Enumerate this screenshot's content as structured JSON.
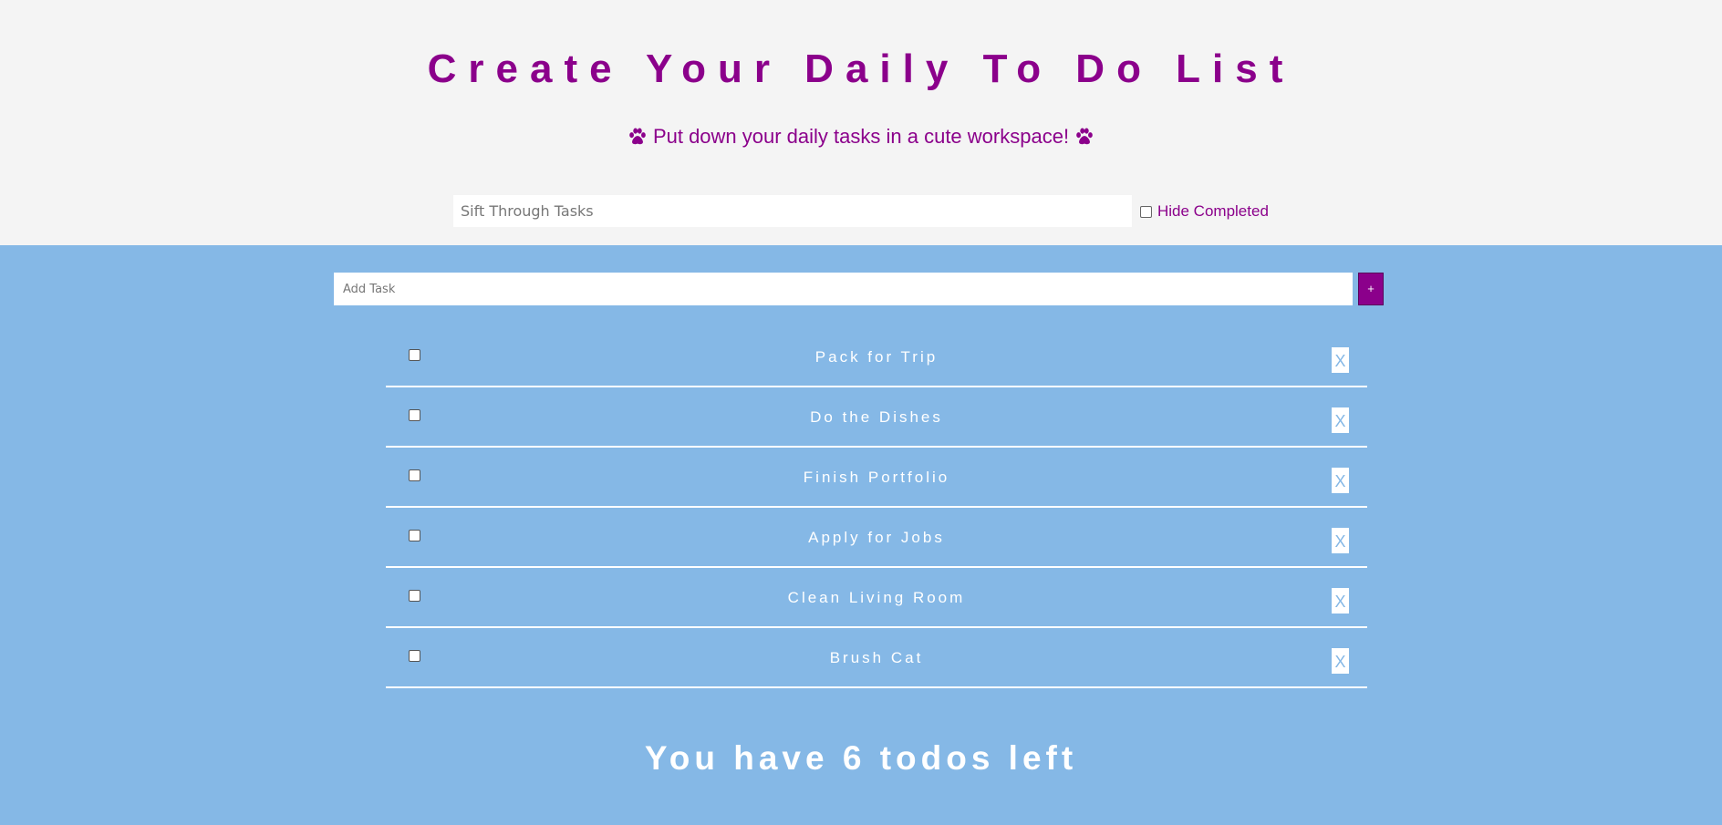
{
  "header": {
    "title": "Create Your Daily To Do List",
    "subtitle": "Put down your daily tasks in a cute workspace!",
    "icon": "paw-icon"
  },
  "filter": {
    "placeholder": "Sift Through Tasks",
    "value": "",
    "hide_completed_label": "Hide Completed",
    "hide_completed_checked": false
  },
  "add_task": {
    "placeholder": "Add Task",
    "button_label": "+"
  },
  "tasks": [
    {
      "label": "Pack for Trip",
      "done": false,
      "delete_label": "X"
    },
    {
      "label": "Do the Dishes",
      "done": false,
      "delete_label": "X"
    },
    {
      "label": "Finish Portfolio",
      "done": false,
      "delete_label": "X"
    },
    {
      "label": "Apply for Jobs",
      "done": false,
      "delete_label": "X"
    },
    {
      "label": "Clean Living Room",
      "done": false,
      "delete_label": "X"
    },
    {
      "label": "Brush Cat",
      "done": false,
      "delete_label": "X"
    }
  ],
  "footer": {
    "remaining_text": "You have 6 todos left"
  },
  "colors": {
    "accent": "#8b008b",
    "background": "#85b8e6",
    "header_background": "#f4f4f4"
  }
}
